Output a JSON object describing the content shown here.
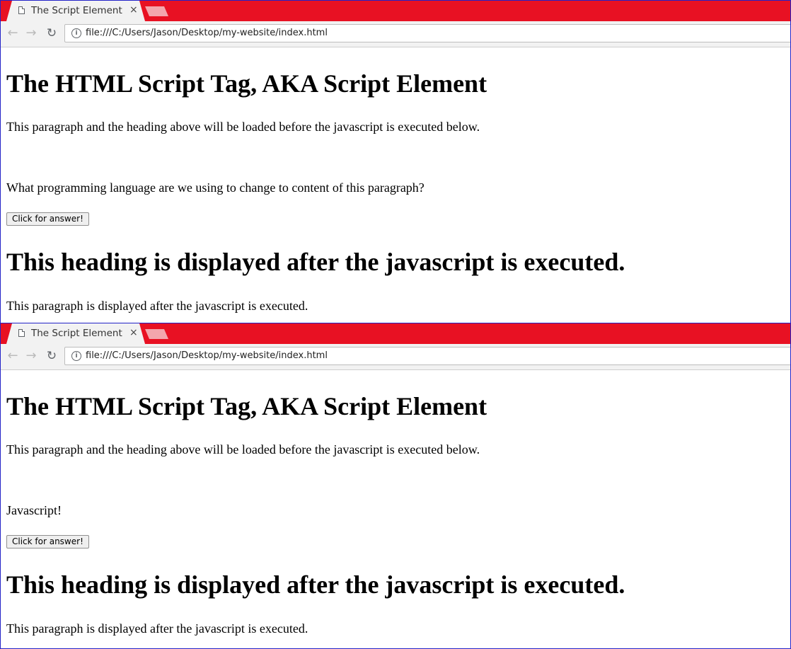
{
  "browser": {
    "tab_title": "The Script Element",
    "tab_close": "×",
    "url": "file:///C:/Users/Jason/Desktop/my-website/index.html"
  },
  "before": {
    "heading": "The HTML Script Tag, AKA Script Element",
    "intro": "This paragraph and the heading above will be loaded before the javascript is executed below.",
    "question": "What programming language are we using to change to content of this paragraph?",
    "button_label": "Click for answer!",
    "heading2": "This heading is displayed after the javascript is executed.",
    "outro": "This paragraph is displayed after the javascript is executed."
  },
  "after": {
    "heading": "The HTML Script Tag, AKA Script Element",
    "intro": "This paragraph and the heading above will be loaded before the javascript is executed below.",
    "answer": "Javascript!",
    "button_label": "Click for answer!",
    "heading2": "This heading is displayed after the javascript is executed.",
    "outro": "This paragraph is displayed after the javascript is executed."
  },
  "icons": [
    "document-icon",
    "close-icon",
    "new-tab-icon",
    "back-arrow-icon",
    "forward-arrow-icon",
    "reload-icon",
    "info-icon"
  ],
  "colors": {
    "tabstrip": "#e81123",
    "frame_border": "#2323c8"
  }
}
